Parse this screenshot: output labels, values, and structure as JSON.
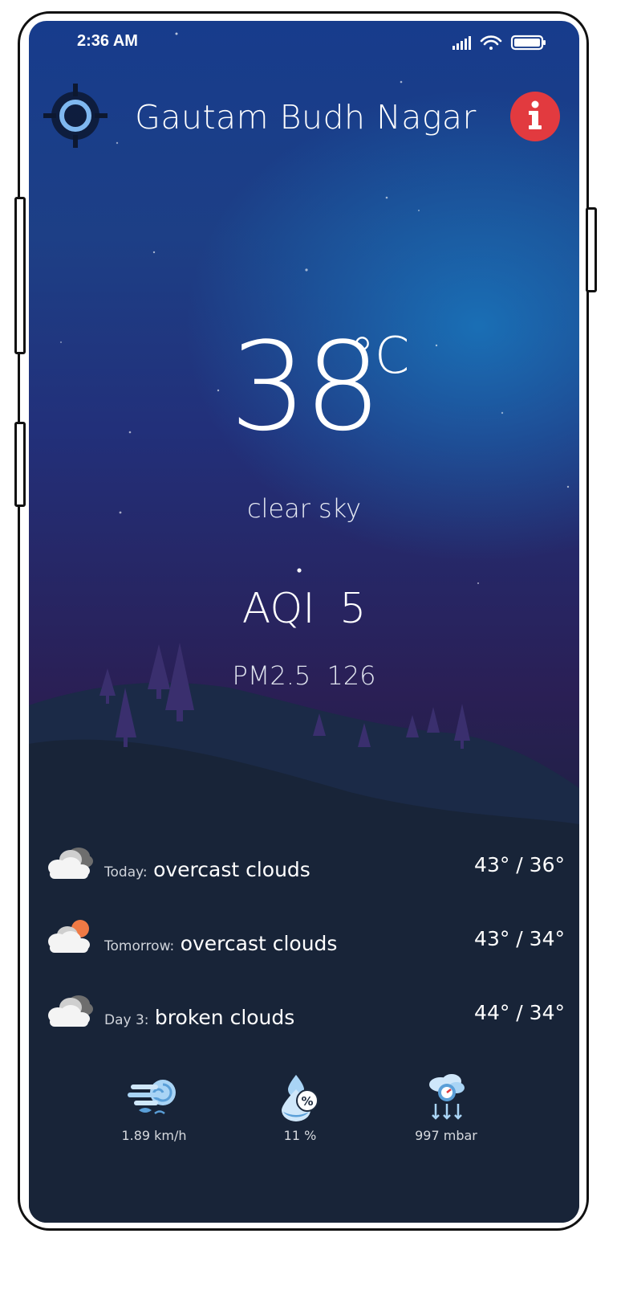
{
  "status_bar": {
    "time": "2:36 AM"
  },
  "header": {
    "city": "Gautam Budh Nagar"
  },
  "current": {
    "temperature": "38",
    "unit": "°C",
    "condition": "clear sky",
    "aqi_label": "AQI",
    "aqi_value": "5",
    "pm_label": "PM2.5",
    "pm_value": "126"
  },
  "forecast": [
    {
      "day": "Today:",
      "description": "overcast clouds",
      "temps": "43° / 36°",
      "icon": "cloudy-icon"
    },
    {
      "day": "Tomorrow:",
      "description": "overcast clouds",
      "temps": "43° / 34°",
      "icon": "cloud-sun-icon"
    },
    {
      "day": "Day 3:",
      "description": "broken clouds",
      "temps": "44° / 34°",
      "icon": "cloudy-icon"
    }
  ],
  "stats": {
    "wind": {
      "value": "1.89 km/h",
      "icon": "wind-icon"
    },
    "humidity": {
      "value": "11 %",
      "icon": "humidity-icon"
    },
    "pressure": {
      "value": "997 mbar",
      "icon": "pressure-icon"
    }
  },
  "colors": {
    "info_button": "#e23a3f",
    "locate_ring": "#7fb8f0",
    "sun": "#f07a45"
  }
}
